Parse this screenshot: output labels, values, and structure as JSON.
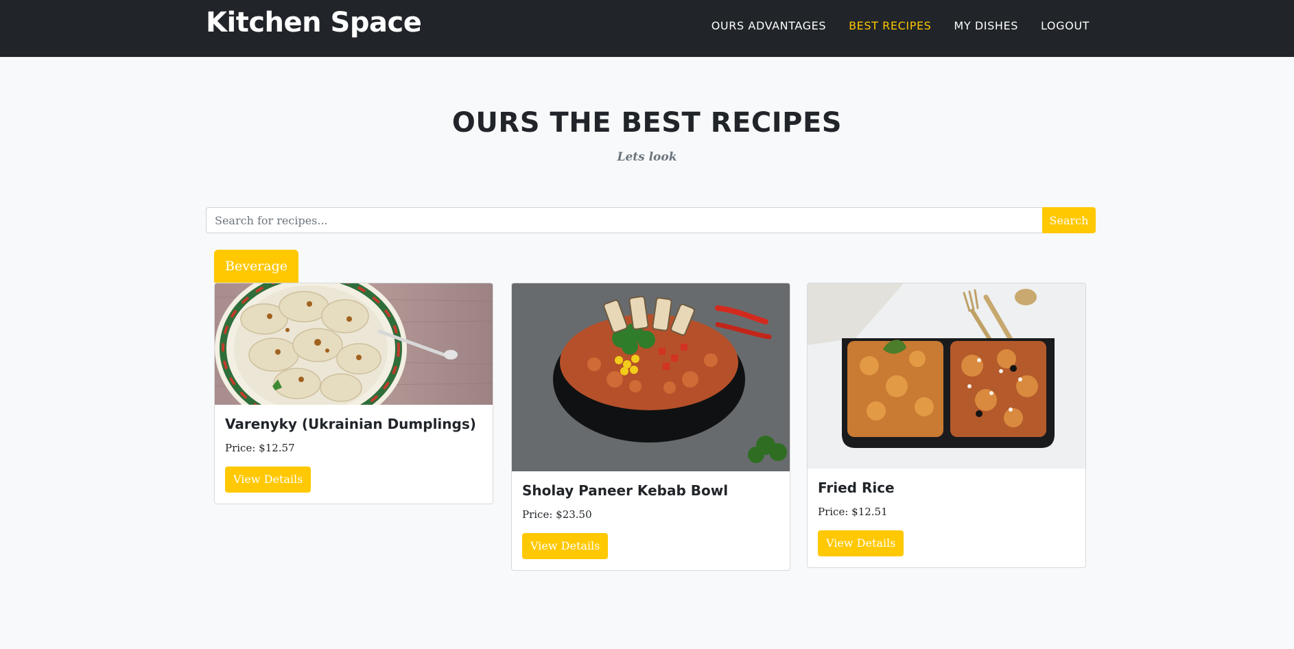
{
  "navbar": {
    "brand": "Kitchen Space",
    "links": [
      {
        "label": "OURS ADVANTAGES",
        "active": false
      },
      {
        "label": "BEST RECIPES",
        "active": true
      },
      {
        "label": "MY DISHES",
        "active": false
      },
      {
        "label": "LOGOUT",
        "active": false
      }
    ]
  },
  "section": {
    "heading": "OURS THE BEST RECIPES",
    "subheading": "Lets look"
  },
  "search": {
    "placeholder": "Search for recipes...",
    "value": "",
    "button_label": "Search"
  },
  "category": {
    "label": "Beverage"
  },
  "recipes": [
    {
      "title": "Varenyky (Ukrainian Dumplings)",
      "price": "Price: $12.57",
      "button_label": "View Details",
      "image": "dumplings-plate-photo"
    },
    {
      "title": "Sholay Paneer Kebab Bowl",
      "price": "Price: $23.50",
      "button_label": "View Details",
      "image": "kebab-rice-bowl-photo"
    },
    {
      "title": "Fried Rice",
      "price": "Price: $12.51",
      "button_label": "View Details",
      "image": "pasta-lunchbox-photo"
    }
  ],
  "colors": {
    "accent": "#ffc800",
    "navbar_bg": "#212529",
    "page_bg": "#f8f9fa"
  }
}
